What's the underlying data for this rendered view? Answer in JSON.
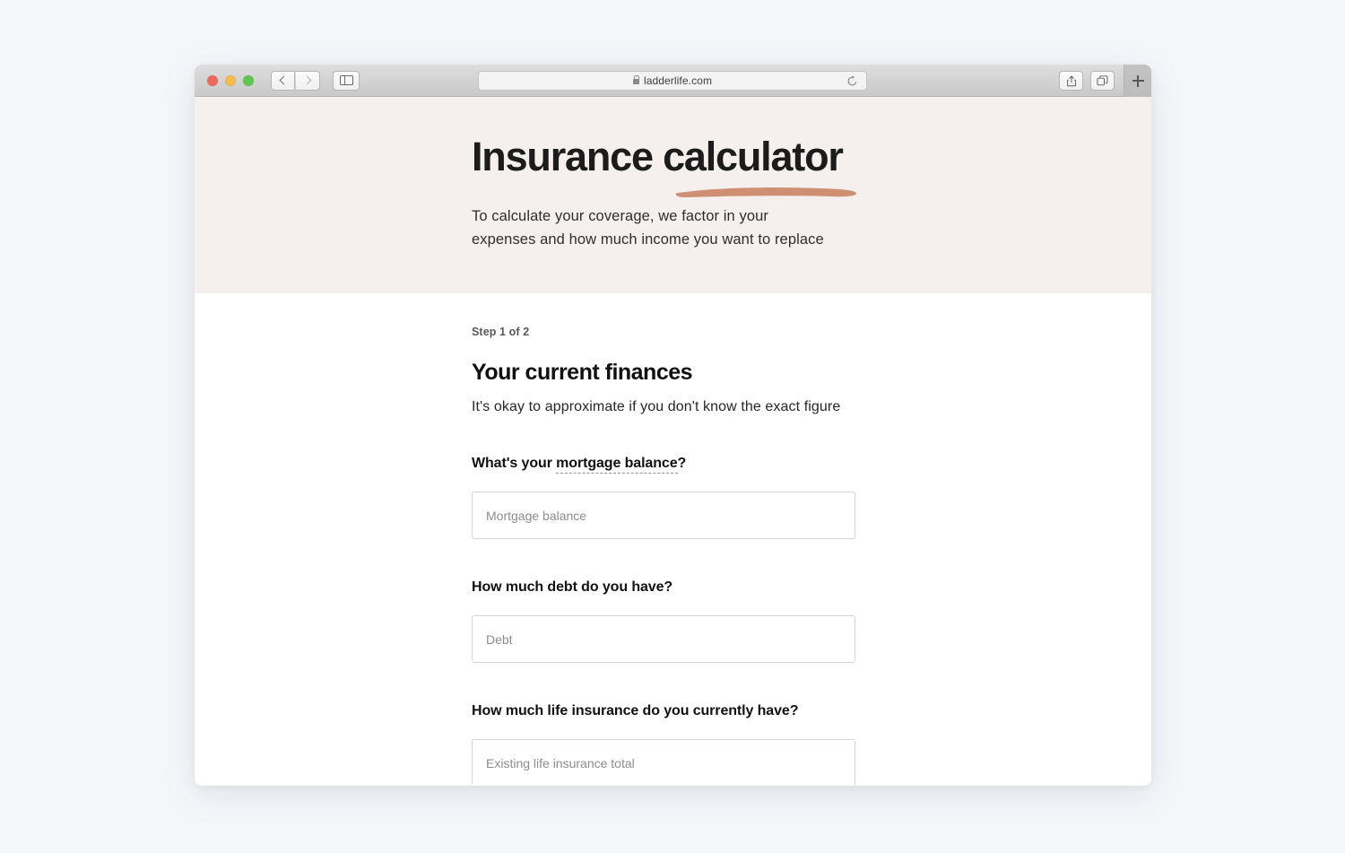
{
  "browser": {
    "url": "ladderlife.com",
    "lock_icon": "lock-icon",
    "reload_icon": "reload-icon",
    "back_icon": "chevron-left-icon",
    "forward_icon": "chevron-right-icon",
    "sidebar_icon": "sidebar-toggle-icon",
    "share_icon": "share-icon",
    "tabs_icon": "show-tabs-icon",
    "newtab_icon": "plus-icon",
    "traffic_lights": {
      "close": "#ee6a5f",
      "minimize": "#f5bd4f",
      "zoom": "#61c554"
    }
  },
  "hero": {
    "title": "Insurance calculator",
    "underline_color": "#cf8f72",
    "background": "#f5f0ed",
    "subtitle_line1": "To calculate your coverage, we factor in your",
    "subtitle_line2": "expenses and how much income you want to replace"
  },
  "form": {
    "step_label": "Step 1 of 2",
    "title": "Your current finances",
    "subtitle": "It's okay to approximate if you don't know the exact figure",
    "fields": [
      {
        "label_prefix": "What's your ",
        "label_term": "mortgage balance",
        "label_suffix": "?",
        "placeholder": "Mortgage balance",
        "value": ""
      },
      {
        "label_prefix": "How much debt do you have?",
        "label_term": "",
        "label_suffix": "",
        "placeholder": "Debt",
        "value": ""
      },
      {
        "label_prefix": "How much life insurance do you currently have?",
        "label_term": "",
        "label_suffix": "",
        "placeholder": "Existing life insurance total",
        "value": ""
      }
    ]
  }
}
